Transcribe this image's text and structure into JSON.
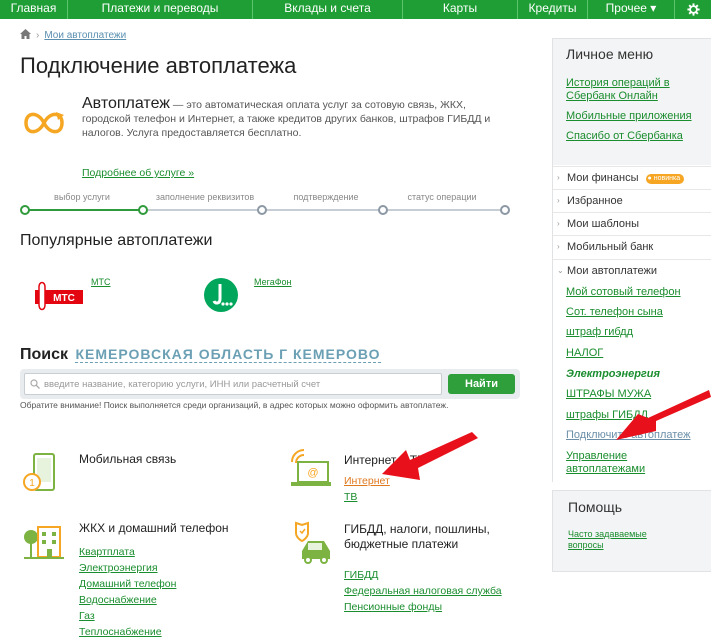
{
  "nav": {
    "items": [
      "Главная",
      "Платежи и переводы",
      "Вклады и счета",
      "Карты",
      "Кредиты",
      "Прочее ▾"
    ]
  },
  "breadcrumb": {
    "link": "Мои автоплатежи"
  },
  "page": {
    "title": "Подключение автоплатежа"
  },
  "intro": {
    "heading": "Автоплатеж",
    "text": " — это автоматическая оплата услуг за сотовую связь, ЖКХ, городской телефон и Интернет, а также кредитов других банков, штрафов ГИБДД и налогов. Услуга предоставляется бесплатно.",
    "more_link": "Подробнее об услуге »"
  },
  "steps": {
    "labels": [
      "выбор услуги",
      "заполнение реквизитов",
      "подтверждение",
      "статус операции"
    ],
    "current": 1
  },
  "popular": {
    "title": "Популярные автоплатежи",
    "items": [
      {
        "label": "МТС",
        "logo_text": "МТС"
      },
      {
        "label": "МегаФон"
      }
    ]
  },
  "search": {
    "label": "Поиск",
    "region": "КЕМЕРОВСКАЯ ОБЛАСТЬ Г КЕМЕРОВО",
    "placeholder": "введите название, категорию услуги, ИНН или расчетный счет",
    "button": "Найти",
    "note": "Обратите внимание! Поиск выполняется среди организаций, в адрес которых можно оформить автоплатеж."
  },
  "categories": {
    "mobile": {
      "title": "Мобильная связь"
    },
    "internet": {
      "title": "Интернет и ТВ",
      "links": [
        "Интернет",
        "ТВ"
      ]
    },
    "housing": {
      "title": "ЖКХ и домашний телефон",
      "links": [
        "Квартплата",
        "Электроэнергия",
        "Домашний телефон",
        "Водоснабжение",
        "Газ",
        "Теплоснабжение"
      ]
    },
    "gibdd": {
      "title_line1": "ГИБДД, налоги, пошлины,",
      "title_line2": "бюджетные платежи",
      "links": [
        "ГИБДД",
        "Федеральная налоговая служба",
        "Пенсионные фонды"
      ]
    }
  },
  "side": {
    "title": "Личное меню",
    "top_links": [
      "История операций в Сбербанк Онлайн",
      "Мобильные приложения",
      "Спасибо от Сбербанка"
    ],
    "rows": [
      "Мои финансы",
      "Избранное",
      "Мои шаблоны",
      "Мобильный банк",
      "Мои автоплатежи"
    ],
    "finances_badge": "новинка",
    "autopay_links": [
      "Мой сотовый телефон",
      "Сот. телефон сына",
      "штраф гибдд",
      "НАЛОГ",
      "Электроэнергия",
      "ШТРАФЫ МУЖА",
      "штрафы ГИБДД",
      "Подключить автоплатеж",
      "Управление автоплатежами"
    ]
  },
  "help": {
    "title": "Помощь",
    "link": "Часто задаваемые вопросы"
  },
  "colors": {
    "brand_green": "#1e9e34",
    "link_green": "#1a8d2e",
    "accent_orange": "#f6a623",
    "annotation_red": "#e8101a"
  }
}
